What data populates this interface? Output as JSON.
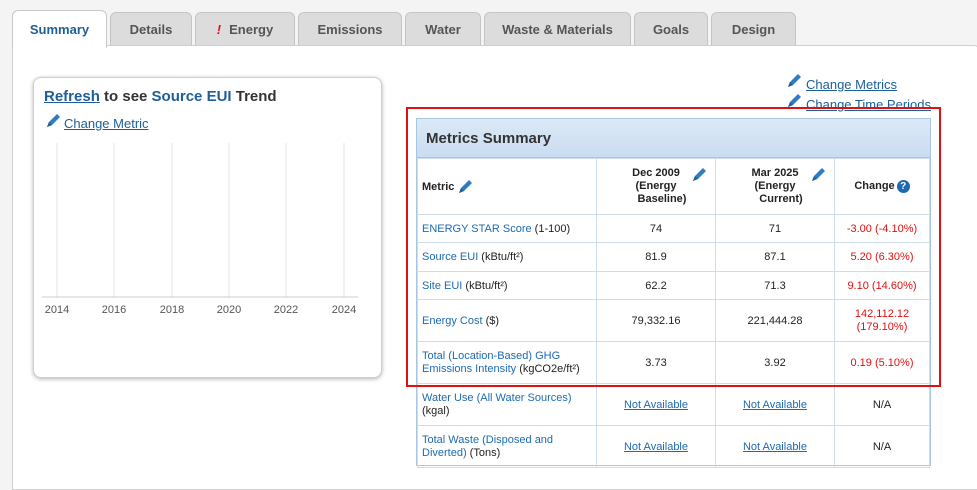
{
  "tabs": [
    {
      "label": "Summary",
      "active": true
    },
    {
      "label": "Details"
    },
    {
      "label": "Energy",
      "alert": "!"
    },
    {
      "label": "Emissions"
    },
    {
      "label": "Water"
    },
    {
      "label": "Waste & Materials"
    },
    {
      "label": "Goals"
    },
    {
      "label": "Design"
    }
  ],
  "trend": {
    "refresh_link": "Refresh",
    "title_mid": " to see ",
    "title_metric": "Source EUI",
    "title_end": " Trend",
    "change_metric": "Change Metric",
    "years": [
      "2014",
      "2016",
      "2018",
      "2020",
      "2022",
      "2024"
    ]
  },
  "links": {
    "change_metrics": "Change Metrics",
    "change_time_periods": "Change Time Periods"
  },
  "metrics": {
    "title": "Metrics Summary",
    "headers": {
      "metric": "Metric",
      "baseline_period": "Dec 2009",
      "baseline_kind": "(Energy",
      "baseline_kind2": "Baseline)",
      "current_period": "Mar 2025",
      "current_kind": "(Energy",
      "current_kind2": "Current)",
      "change": "Change",
      "help": "?"
    },
    "rows": [
      {
        "link": "ENERGY STAR Score",
        "unit": " (1-100)",
        "baseline": "74",
        "current": "71",
        "change": "-3.00 (-4.10%)"
      },
      {
        "link": "Source EUI",
        "unit": " (kBtu/ft²)",
        "baseline": "81.9",
        "current": "87.1",
        "change": "5.20 (6.30%)"
      },
      {
        "link": "Site EUI",
        "unit": " (kBtu/ft²)",
        "baseline": "62.2",
        "current": "71.3",
        "change": "9.10 (14.60%)"
      },
      {
        "link": "Energy Cost",
        "unit": " ($)",
        "baseline": "79,332.16",
        "current": "221,444.28",
        "change": "142,112.12",
        "change2": "(179.10%)"
      },
      {
        "link": "Total (Location-Based) GHG Emissions Intensity",
        "unit": " (kgCO2e/ft²)",
        "baseline": "3.73",
        "current": "3.92",
        "change": "0.19 (5.10%)"
      },
      {
        "link": "Water Use (All Water Sources)",
        "unit": " (kgal)",
        "baseline": "Not Available",
        "current": "Not Available",
        "change": "N/A"
      },
      {
        "link": "Total Waste (Disposed and Diverted)",
        "unit": " (Tons)",
        "baseline": "Not Available",
        "current": "Not Available",
        "change": "N/A"
      }
    ]
  }
}
